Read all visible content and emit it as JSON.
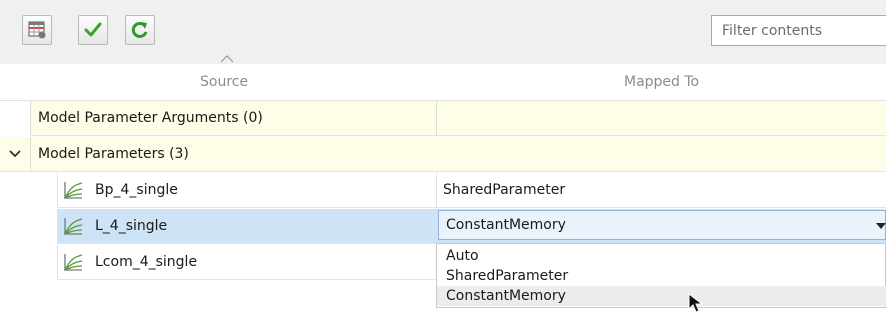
{
  "toolbar": {
    "buttons": [
      {
        "icon": "table-settings-icon"
      },
      {
        "icon": "check-icon"
      },
      {
        "icon": "refresh-icon"
      }
    ],
    "filter_placeholder": "Filter contents"
  },
  "columns": {
    "source": "Source",
    "mapped_to": "Mapped To"
  },
  "groups": [
    {
      "label": "Model Parameter Arguments (0)",
      "expanded": false
    },
    {
      "label": "Model Parameters (3)",
      "expanded": true
    }
  ],
  "parameters": [
    {
      "name": "Bp_4_single",
      "mapped_to": "SharedParameter"
    },
    {
      "name": "L_4_single",
      "mapped_to": "ConstantMemory",
      "selected": true
    },
    {
      "name": "Lcom_4_single",
      "mapped_to": ""
    }
  ],
  "dropdown": {
    "options": [
      "Auto",
      "SharedParameter",
      "ConstantMemory"
    ],
    "highlighted": "ConstantMemory"
  },
  "colors": {
    "group_bg": "#fdfde8",
    "selected_bg": "#cfe3f7",
    "toolbar_bg": "#f0f0f0"
  }
}
